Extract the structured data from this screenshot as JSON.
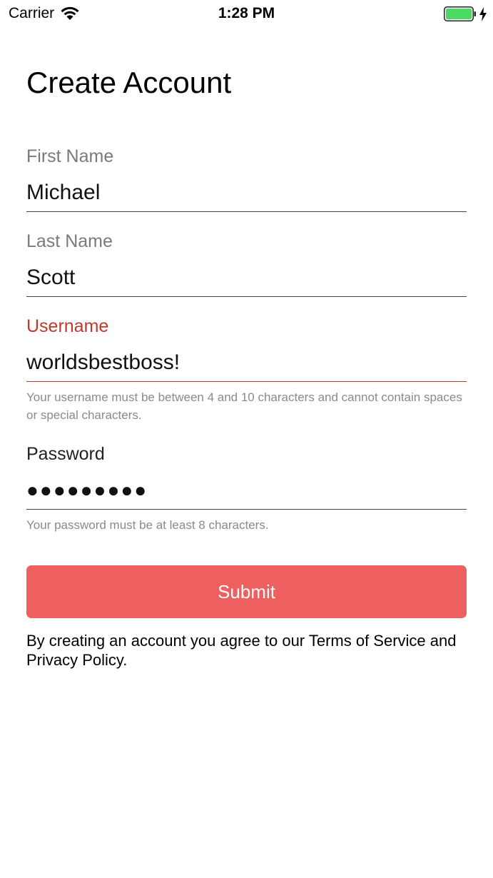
{
  "status_bar": {
    "carrier": "Carrier",
    "time": "1:28 PM",
    "wifi_icon": "wifi-icon",
    "battery_icon": "battery-full-icon",
    "charging_icon": "charging-bolt-icon",
    "battery_color": "#4cd964"
  },
  "page": {
    "title": "Create Account"
  },
  "form": {
    "first_name": {
      "label": "First Name",
      "value": "Michael"
    },
    "last_name": {
      "label": "Last Name",
      "value": "Scott"
    },
    "username": {
      "label": "Username",
      "value": "worldsbestboss!",
      "helper": "Your username must be between 4 and 10 characters and cannot contain spaces or special characters.",
      "error_color": "#c0392b"
    },
    "password": {
      "label": "Password",
      "value": "●●●●●●●●●",
      "helper": "Your password must be at least 8 characters."
    },
    "submit_label": "Submit",
    "submit_color": "#ee6060",
    "terms": "By creating an account you agree to our Terms of Service and Privacy Policy."
  }
}
